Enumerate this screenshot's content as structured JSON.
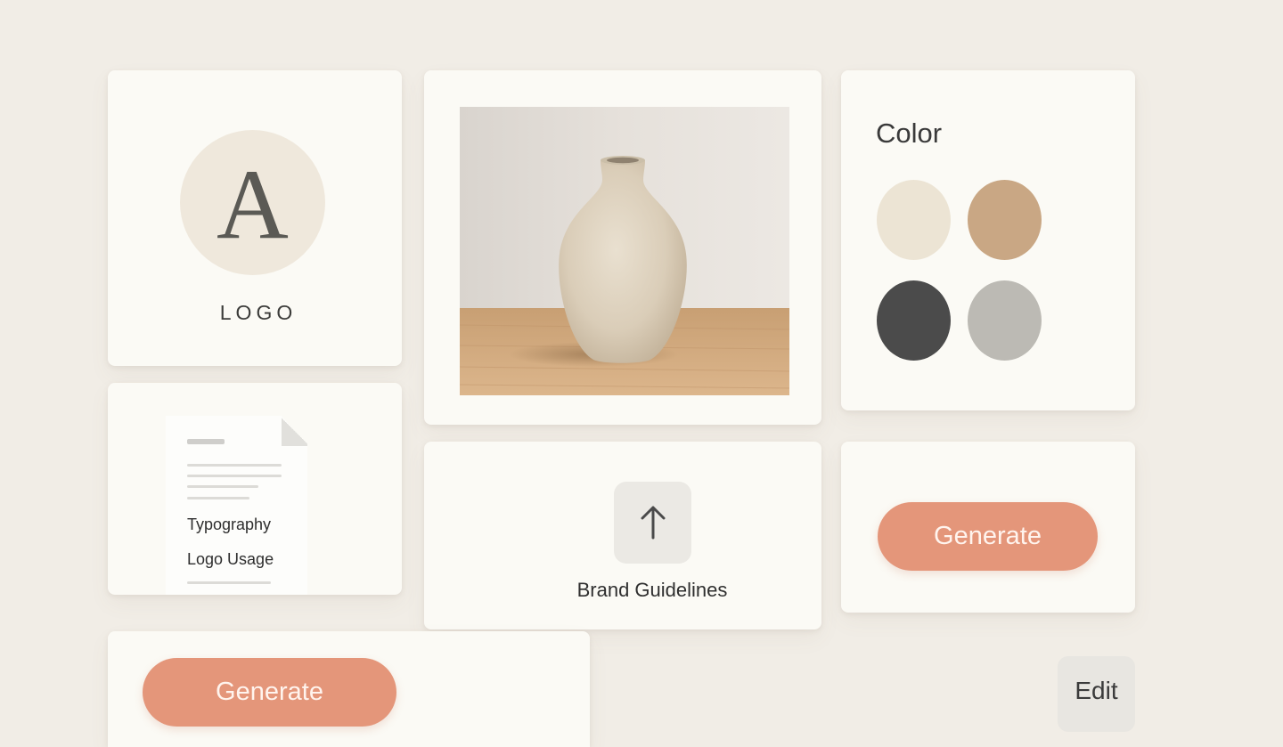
{
  "logo_card": {
    "letter": "A",
    "label": "LOGO"
  },
  "image_card": {
    "image": "ceramic-vase-photo"
  },
  "color_card": {
    "title": "Color",
    "swatches": [
      "#ece4d4",
      "#c9a784",
      "#4b4b4b",
      "#bcbab4"
    ]
  },
  "doc_card": {
    "items": [
      "Typography",
      "Logo Usage"
    ]
  },
  "upload_card": {
    "icon": "arrow-up-icon",
    "label": "Brand Guidelines"
  },
  "generate_card_1": {
    "button_label": "Generate"
  },
  "generate_card_2": {
    "button_label": "Generate"
  },
  "edit": {
    "label": "Edit"
  },
  "colors": {
    "accent": "#e4967a",
    "background": "#f1ede6",
    "card": "#fbfaf5"
  }
}
